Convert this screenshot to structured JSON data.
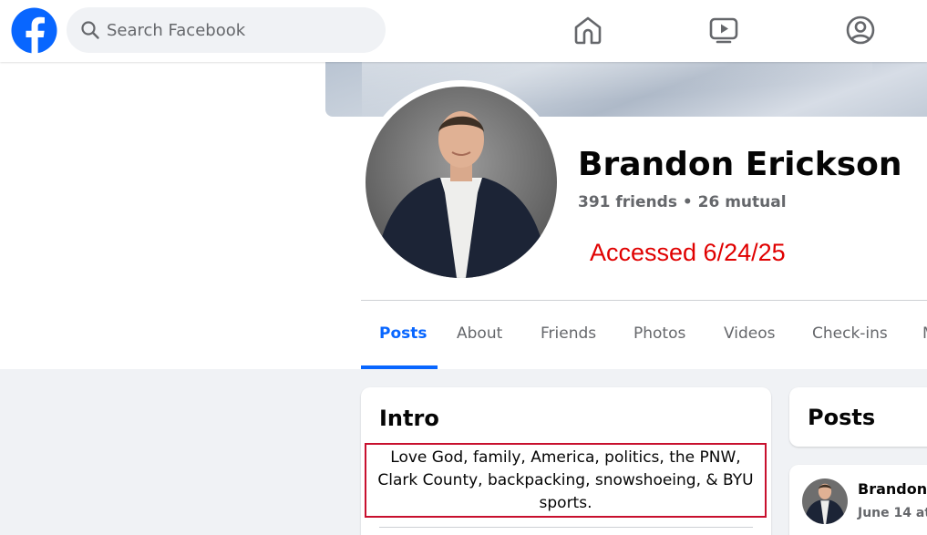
{
  "header": {
    "search_placeholder": "Search Facebook",
    "nav": [
      "home-icon",
      "video-icon",
      "profile-icon"
    ]
  },
  "profile": {
    "name": "Brandon Erickson",
    "friends_line": "391 friends • 26 mutual",
    "annotation": "Accessed 6/24/25"
  },
  "tabs": [
    {
      "label": "Posts",
      "active": true
    },
    {
      "label": "About"
    },
    {
      "label": "Friends"
    },
    {
      "label": "Photos"
    },
    {
      "label": "Videos"
    },
    {
      "label": "Check-ins"
    },
    {
      "label": "M"
    }
  ],
  "intro": {
    "title": "Intro",
    "bio_lines": [
      "Love God, family, America, politics, the PNW,",
      "Clark County, backpacking, snowshoeing, & BYU",
      "sports."
    ]
  },
  "posts": {
    "title": "Posts",
    "first_post": {
      "author": "Brandon",
      "date": "June 14 at"
    }
  },
  "colors": {
    "brand_blue": "#0866ff",
    "annotation_red": "#e00000",
    "highlight_box": "#c8102e"
  }
}
